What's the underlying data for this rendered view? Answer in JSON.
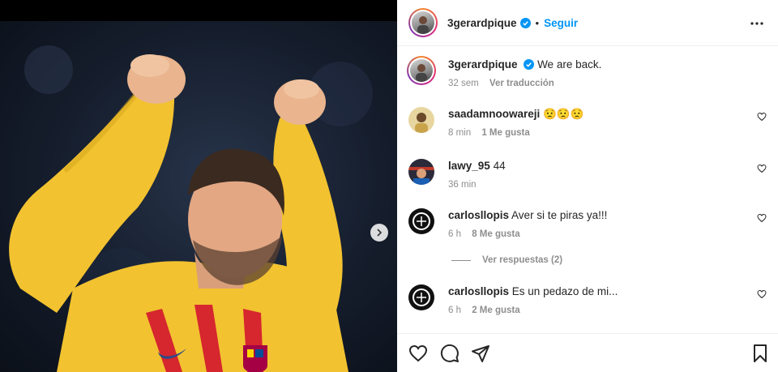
{
  "post": {
    "username": "3gerardpique",
    "follow_label": "Seguir",
    "separator": "•",
    "caption": "We are back.",
    "caption_time": "32 sem",
    "translate_label": "Ver traducción"
  },
  "comments": [
    {
      "username": "saadamnoowareji",
      "text": "😟😟😟",
      "time": "8 min",
      "likes": "1 Me gusta"
    },
    {
      "username": "lawy_95",
      "text": "44",
      "time": "36 min",
      "likes": ""
    },
    {
      "username": "carlosllopis",
      "text": "Aver si te piras ya!!!",
      "time": "6 h",
      "likes": "8 Me gusta"
    },
    {
      "username": "carlosllopis",
      "text": "Es un pedazo de mi...",
      "time": "6 h",
      "likes": "2 Me gusta"
    }
  ],
  "view_replies_label": "Ver respuestas (2)",
  "colors": {
    "accent": "#0095f6",
    "secondary_text": "#8e8e8e",
    "jersey_yellow": "#f2c230",
    "stripe_red": "#d6262e"
  },
  "icons": [
    "verified-badge-icon",
    "more-options-icon",
    "heart-icon",
    "comment-icon",
    "share-icon",
    "save-icon",
    "chevron-right-icon"
  ]
}
